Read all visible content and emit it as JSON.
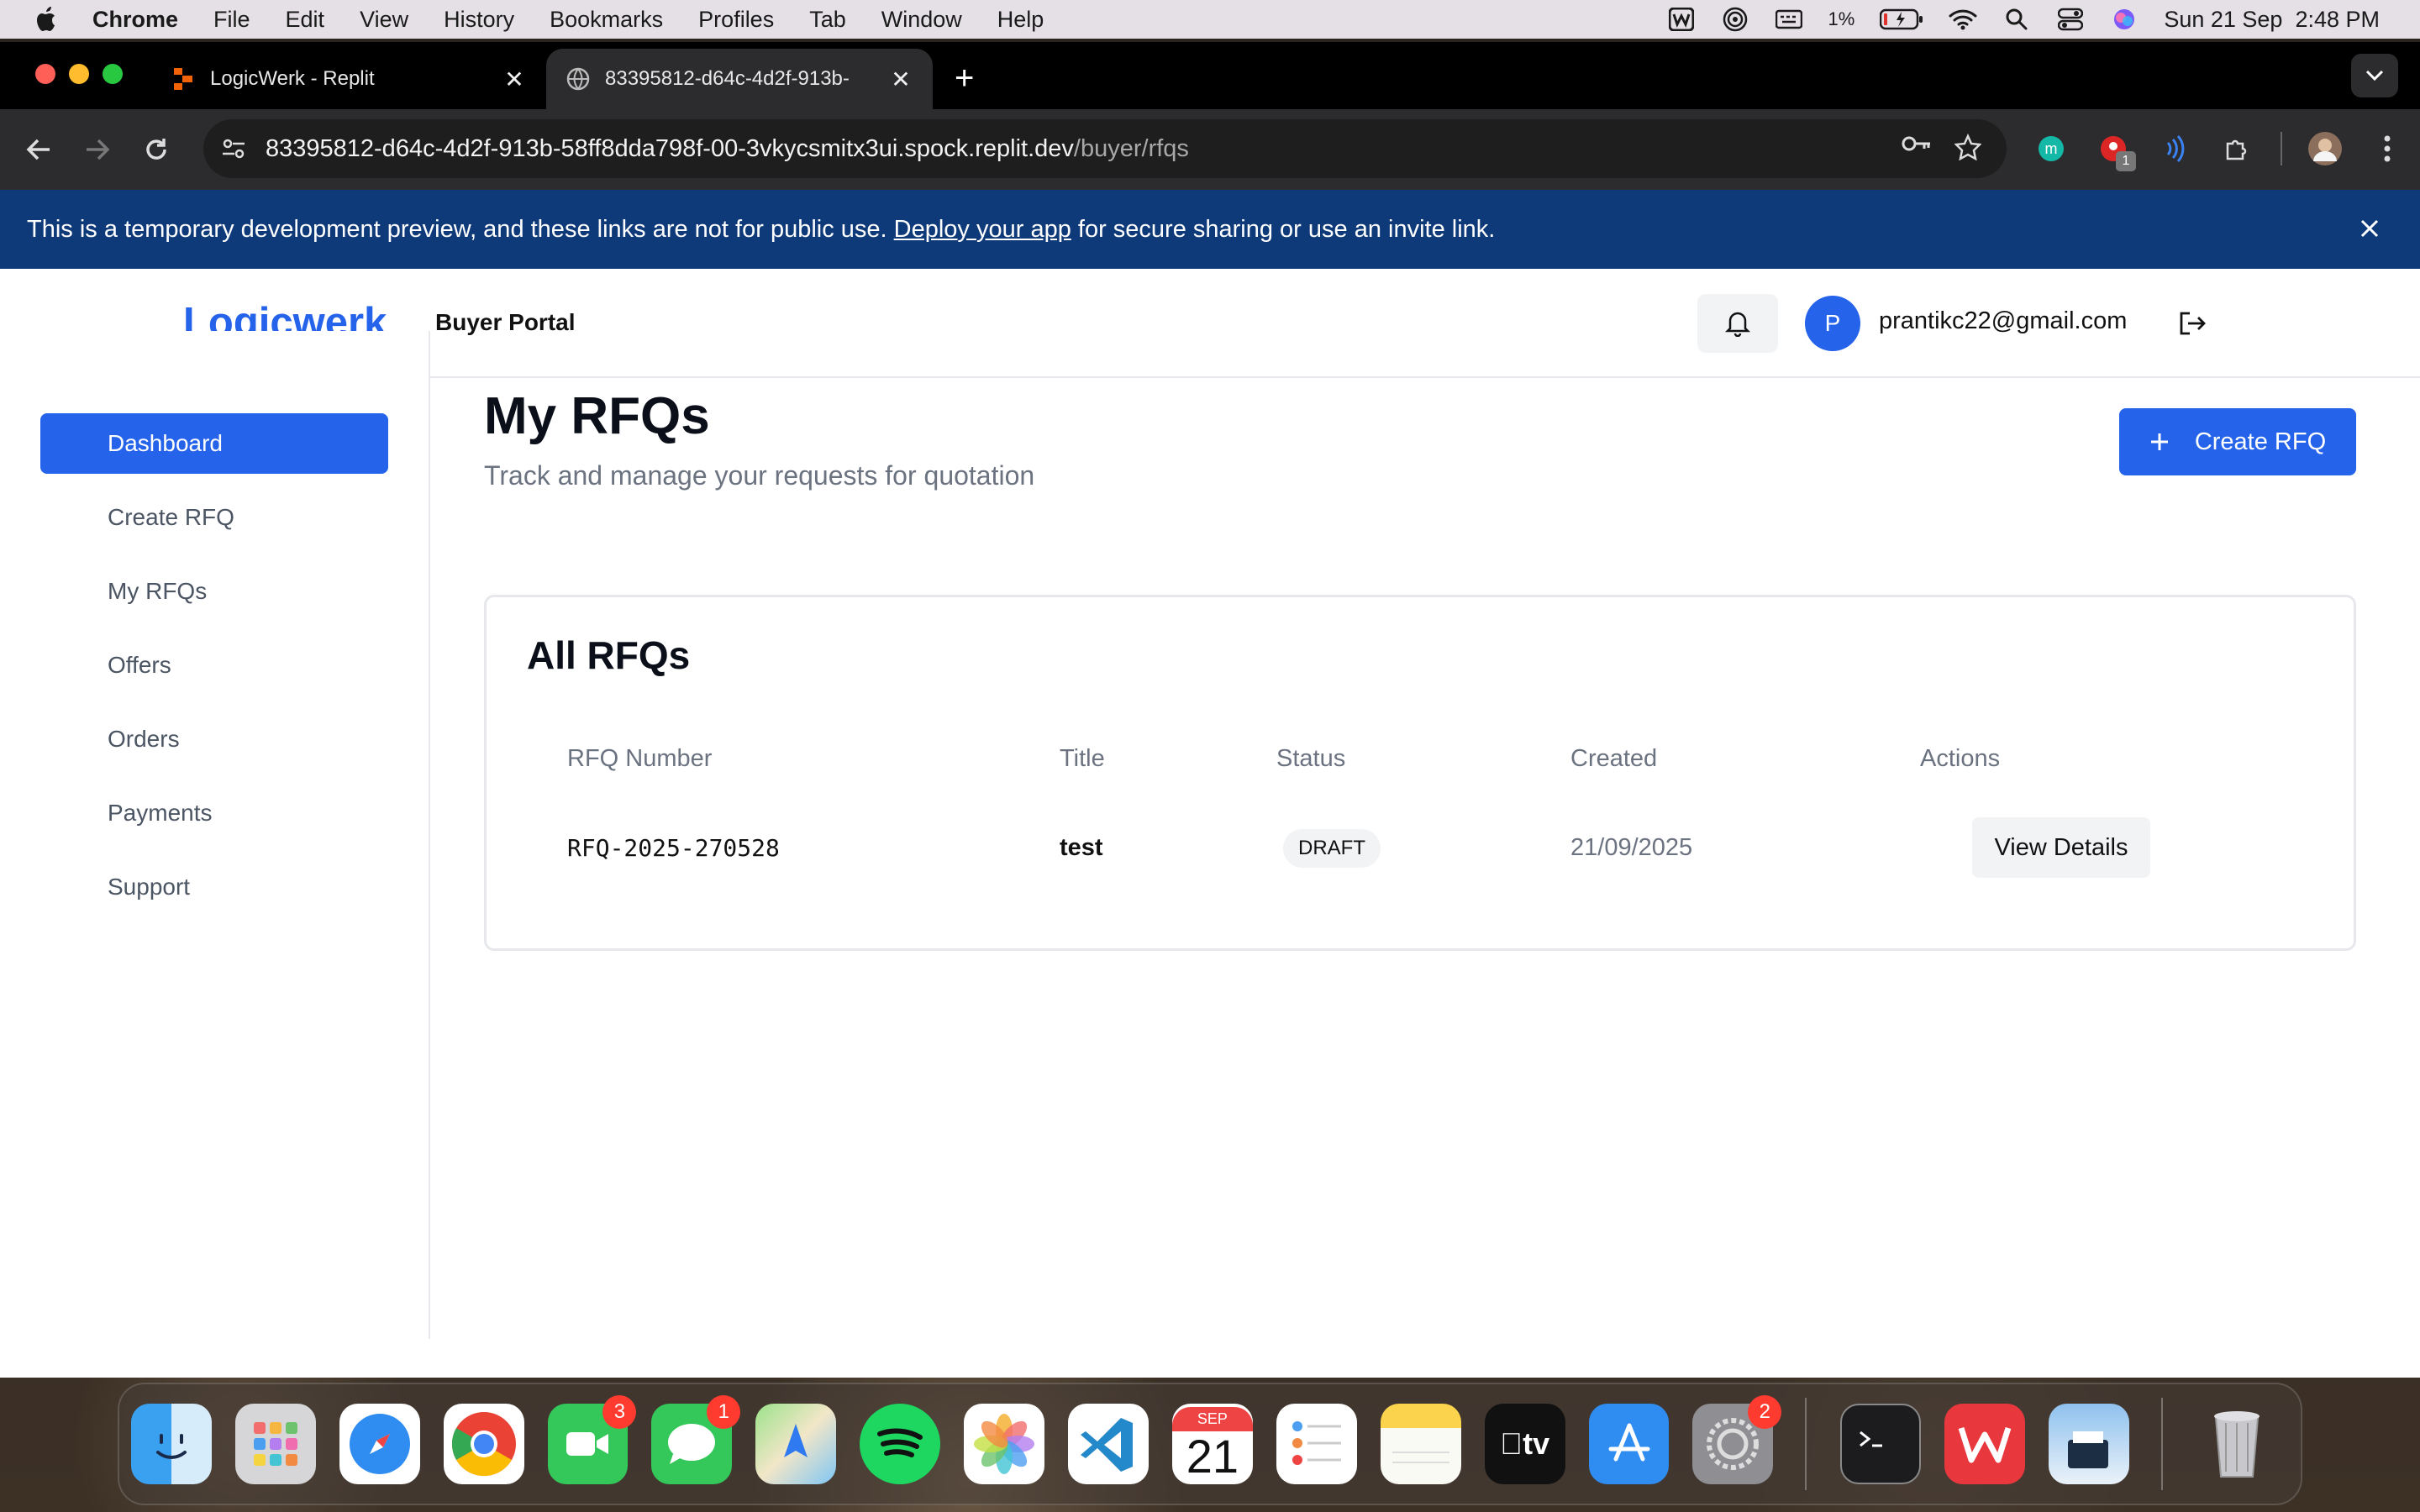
{
  "menubar": {
    "app_name": "Chrome",
    "items": [
      "File",
      "Edit",
      "View",
      "History",
      "Bookmarks",
      "Profiles",
      "Tab",
      "Window",
      "Help"
    ],
    "battery": "1%",
    "datetime": "Sun 21 Sep  2:48 PM"
  },
  "browser": {
    "tabs": [
      {
        "title": "LogicWerk - Replit",
        "active": false
      },
      {
        "title": "83395812-d64c-4d2f-913b-",
        "active": true
      }
    ],
    "url_host": "83395812-d64c-4d2f-913b-58ff8dda798f-00-3vkycsmitx3ui.spock.replit.dev",
    "url_path": "/buyer/rfqs",
    "extension_badge": "1"
  },
  "banner": {
    "text_before": "This is a temporary development preview, and these links are not for public use. ",
    "link": "Deploy your app",
    "text_after": " for secure sharing or use an invite link."
  },
  "header": {
    "logo": "Logicwerk",
    "portal": "Buyer Portal",
    "avatar_letter": "P",
    "email": "prantikc22@gmail.com"
  },
  "sidebar": {
    "items": [
      {
        "label": "Dashboard",
        "active": true
      },
      {
        "label": "Create RFQ",
        "active": false
      },
      {
        "label": "My RFQs",
        "active": false
      },
      {
        "label": "Offers",
        "active": false
      },
      {
        "label": "Orders",
        "active": false
      },
      {
        "label": "Payments",
        "active": false
      },
      {
        "label": "Support",
        "active": false
      }
    ]
  },
  "main": {
    "title": "My RFQs",
    "subtitle": "Track and manage your requests for quotation",
    "create_button": "Create RFQ",
    "card_title": "All RFQs",
    "columns": [
      "RFQ Number",
      "Title",
      "Status",
      "Created",
      "Actions"
    ],
    "rows": [
      {
        "rfq_number": "RFQ-2025-270528",
        "title": "test",
        "status": "DRAFT",
        "created": "21/09/2025",
        "action": "View Details"
      }
    ]
  },
  "dock": {
    "apps": [
      {
        "name": "Finder"
      },
      {
        "name": "Launchpad"
      },
      {
        "name": "Safari"
      },
      {
        "name": "Chrome"
      },
      {
        "name": "FaceTime",
        "badge": "3"
      },
      {
        "name": "Messages",
        "badge": "1"
      },
      {
        "name": "Maps"
      },
      {
        "name": "Spotify"
      },
      {
        "name": "Photos"
      },
      {
        "name": "VS Code"
      },
      {
        "name": "Calendar",
        "month": "SEP",
        "day": "21"
      },
      {
        "name": "Reminders"
      },
      {
        "name": "Notes"
      },
      {
        "name": "TV",
        "label": "tv"
      },
      {
        "name": "App Store"
      },
      {
        "name": "System Settings",
        "badge": "2"
      },
      {
        "name": "Terminal"
      },
      {
        "name": "WPS"
      },
      {
        "name": "Preview"
      },
      {
        "name": "Trash"
      }
    ]
  },
  "colors": {
    "brand": "#2563eb",
    "banner": "#0f3a7a"
  }
}
